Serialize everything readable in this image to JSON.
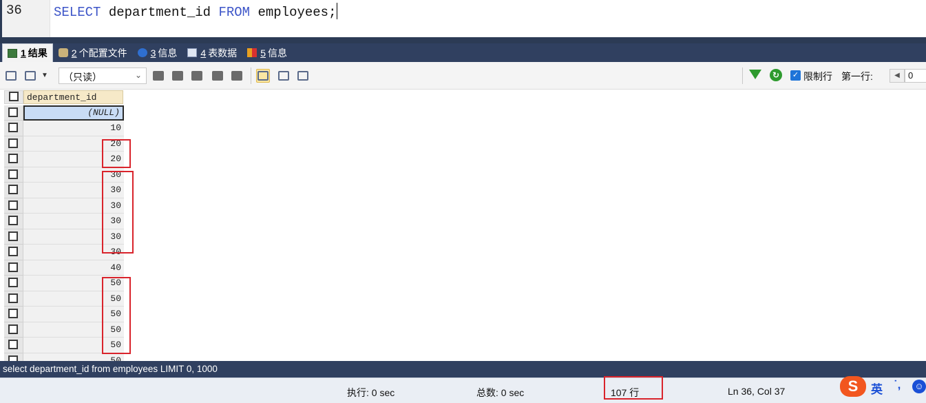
{
  "editor": {
    "line_number": "36",
    "code_keyword1": "SELECT",
    "code_mid": " department_id ",
    "code_keyword2": "FROM",
    "code_tail": " employees;"
  },
  "tabs": [
    {
      "num": "1",
      "label": "结果",
      "icon": "result-table-icon",
      "active": true
    },
    {
      "num": "2",
      "label": "个配置文件",
      "icon": "profile-icon",
      "active": false
    },
    {
      "num": "3",
      "label": "信息",
      "icon": "info-icon",
      "active": false
    },
    {
      "num": "4",
      "label": "表数据",
      "icon": "table-data-icon",
      "active": false
    },
    {
      "num": "5",
      "label": "信息",
      "icon": "info-colored-icon",
      "active": false
    }
  ],
  "toolbar": {
    "mode_value": "（只读）",
    "limit_rows_label": "限制行",
    "first_row_label": "第一行:",
    "first_row_value": "0"
  },
  "grid": {
    "column_header": "department_id",
    "rows": [
      "(NULL)",
      "10",
      "20",
      "20",
      "30",
      "30",
      "30",
      "30",
      "30",
      "30",
      "40",
      "50",
      "50",
      "50",
      "50",
      "50",
      "50"
    ]
  },
  "status": {
    "query": "select department_id from employees LIMIT 0, 1000",
    "exec_time": "执行: 0 sec",
    "total_time": "总数: 0 sec",
    "rows": "107 行",
    "cursor_pos": "Ln 36, Col 37"
  },
  "ime": {
    "logo": "S",
    "lang": "英",
    "punct": "˙,",
    "emoji": "☺"
  },
  "colors": {
    "header_bar": "#304060",
    "highlight_red": "#d9232b",
    "keyword_blue": "#3d55c8"
  }
}
